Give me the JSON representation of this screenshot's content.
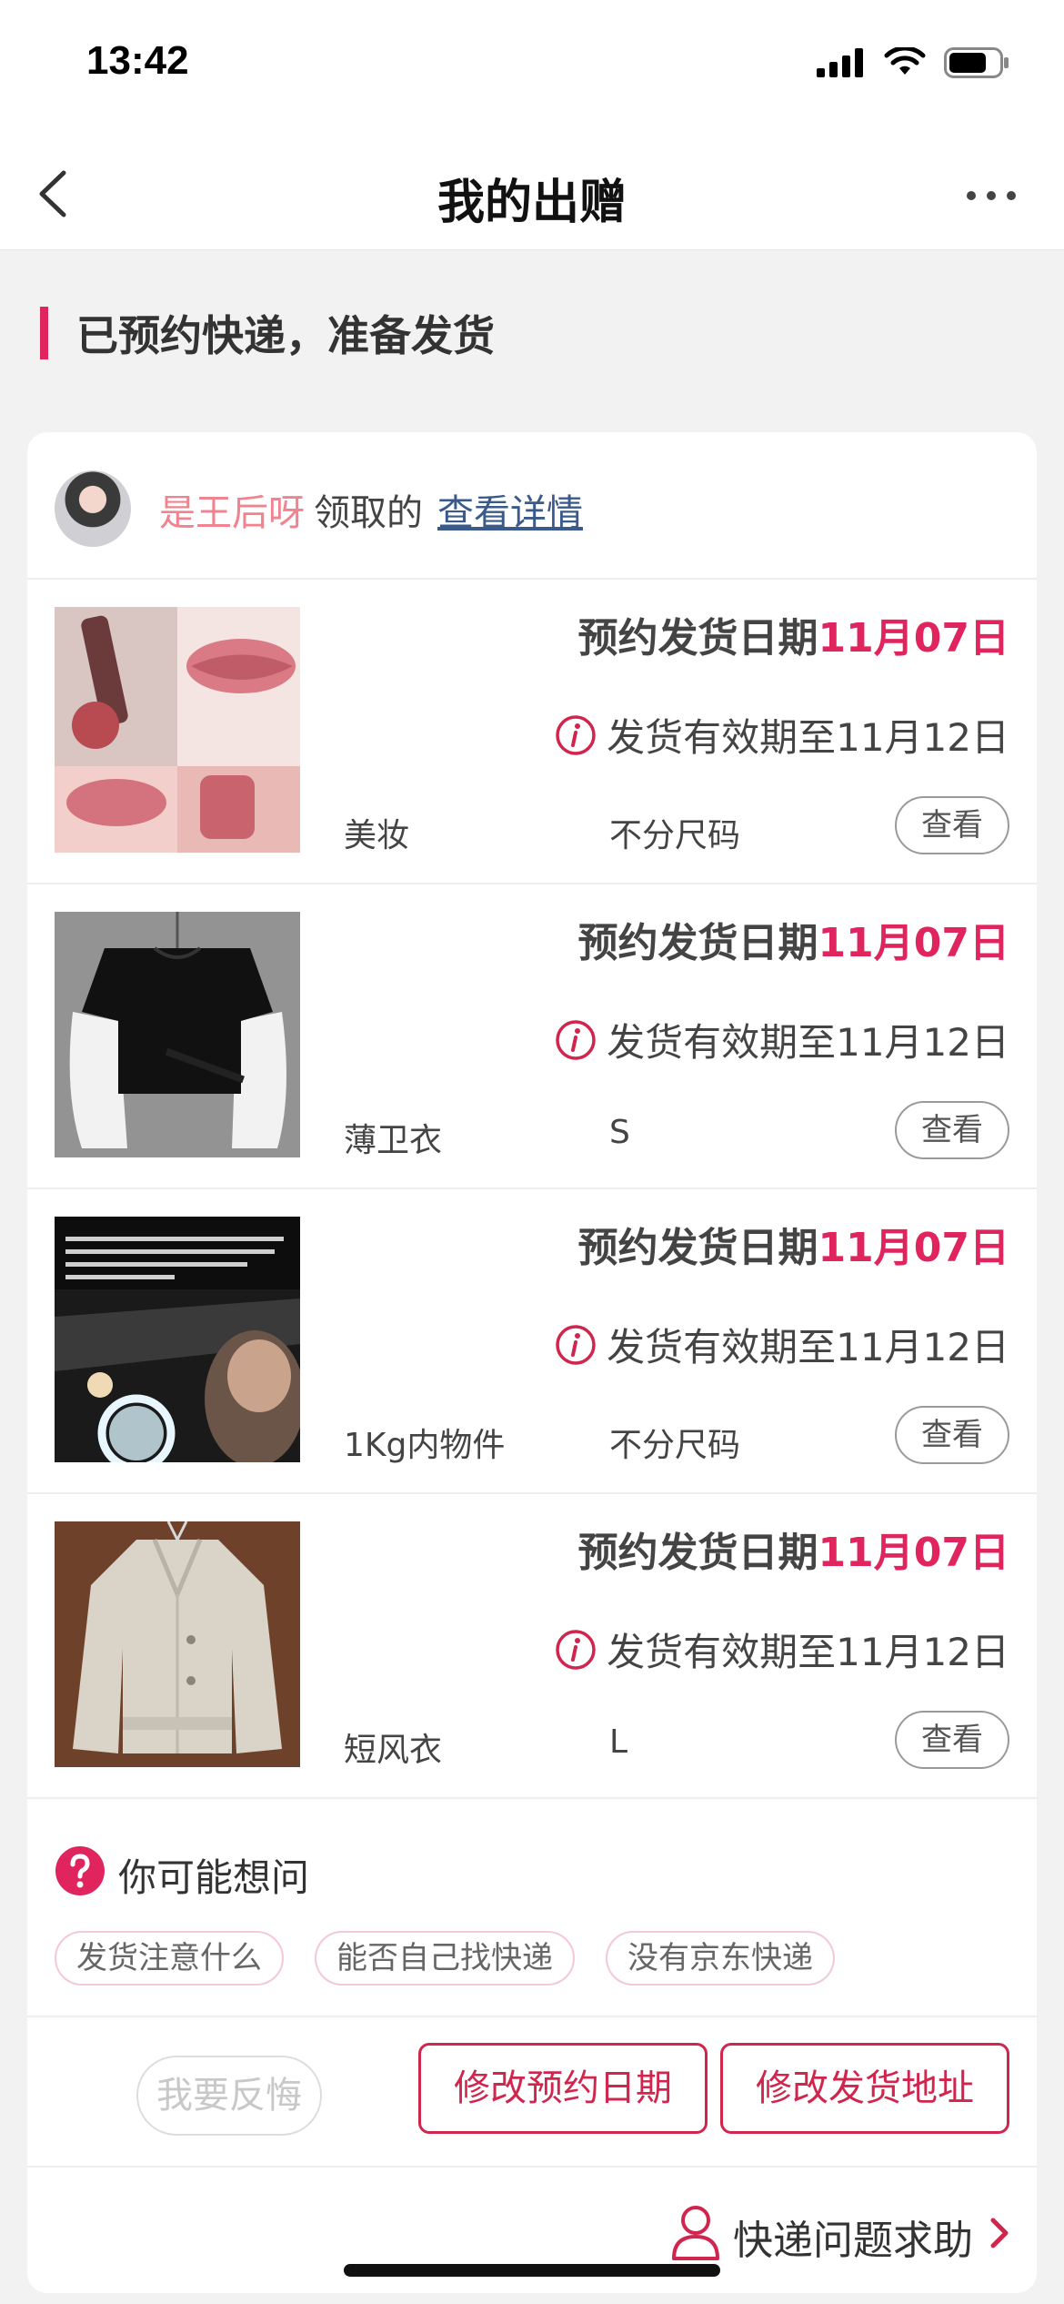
{
  "status_bar": {
    "time": "13:42"
  },
  "nav": {
    "title": "我的出赠"
  },
  "section": {
    "title": "已预约快递，准备发货"
  },
  "receiver": {
    "name": "是王后呀",
    "suffix": "领取的",
    "detail_link": "查看详情"
  },
  "items": [
    {
      "ship_label": "预约发货日期",
      "ship_date": "11月07日",
      "valid_text": "发货有效期至11月12日",
      "name": "美妆",
      "size": "不分尺码",
      "view_label": "查看"
    },
    {
      "ship_label": "预约发货日期",
      "ship_date": "11月07日",
      "valid_text": "发货有效期至11月12日",
      "name": "薄卫衣",
      "size": "S",
      "view_label": "查看"
    },
    {
      "ship_label": "预约发货日期",
      "ship_date": "11月07日",
      "valid_text": "发货有效期至11月12日",
      "name": "1Kg内物件",
      "size": "不分尺码",
      "view_label": "查看"
    },
    {
      "ship_label": "预约发货日期",
      "ship_date": "11月07日",
      "valid_text": "发货有效期至11月12日",
      "name": "短风衣",
      "size": "L",
      "view_label": "查看"
    }
  ],
  "faq": {
    "title": "你可能想问",
    "tags": [
      "发货注意什么",
      "能否自己找快递",
      "没有京东快递"
    ]
  },
  "actions": {
    "regret": "我要反悔",
    "modify_date": "修改预约日期",
    "modify_address": "修改发货地址"
  },
  "help": {
    "label": "快递问题求助"
  },
  "colors": {
    "accent": "#e0245e",
    "name_pink": "#f0838f",
    "link_blue": "#3a5a8c"
  },
  "icons": [
    "back-icon",
    "more-icon",
    "info-icon",
    "question-icon",
    "person-icon",
    "chevron-right-icon",
    "signal-icon",
    "wifi-icon",
    "battery-icon"
  ]
}
